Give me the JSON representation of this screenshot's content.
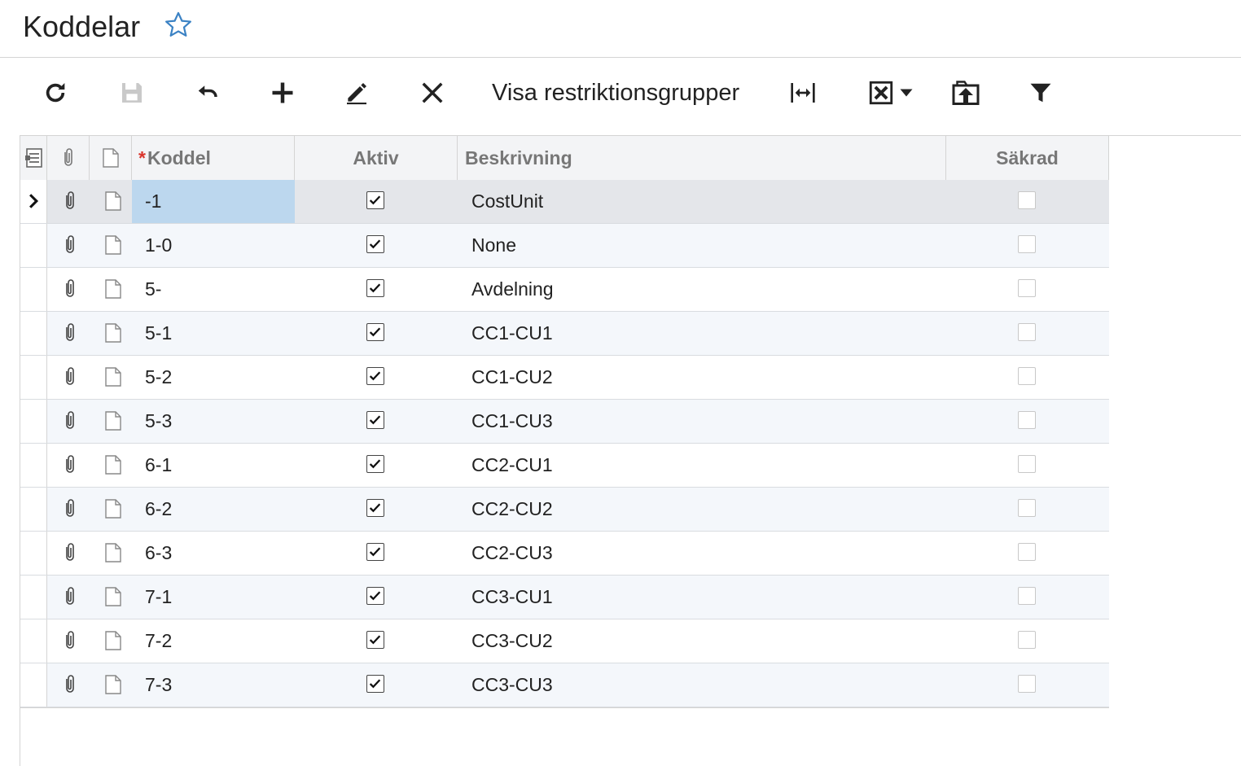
{
  "page": {
    "title": "Koddelar"
  },
  "toolbar": {
    "restriction_groups_label": "Visa restriktionsgrupper"
  },
  "grid": {
    "columns": {
      "koddel": "Koddel",
      "koddel_required_marker": "*",
      "aktiv": "Aktiv",
      "beskrivning": "Beskrivning",
      "sakrad": "Säkrad"
    },
    "rows": [
      {
        "koddel": "-1",
        "aktiv": true,
        "beskrivning": "CostUnit",
        "sakrad": false,
        "selected": true
      },
      {
        "koddel": "1-0",
        "aktiv": true,
        "beskrivning": "None",
        "sakrad": false
      },
      {
        "koddel": "5-",
        "aktiv": true,
        "beskrivning": "Avdelning",
        "sakrad": false
      },
      {
        "koddel": "5-1",
        "aktiv": true,
        "beskrivning": "CC1-CU1",
        "sakrad": false
      },
      {
        "koddel": "5-2",
        "aktiv": true,
        "beskrivning": "CC1-CU2",
        "sakrad": false
      },
      {
        "koddel": "5-3",
        "aktiv": true,
        "beskrivning": "CC1-CU3",
        "sakrad": false
      },
      {
        "koddel": "6-1",
        "aktiv": true,
        "beskrivning": "CC2-CU1",
        "sakrad": false
      },
      {
        "koddel": "6-2",
        "aktiv": true,
        "beskrivning": "CC2-CU2",
        "sakrad": false
      },
      {
        "koddel": "6-3",
        "aktiv": true,
        "beskrivning": "CC2-CU3",
        "sakrad": false
      },
      {
        "koddel": "7-1",
        "aktiv": true,
        "beskrivning": "CC3-CU1",
        "sakrad": false
      },
      {
        "koddel": "7-2",
        "aktiv": true,
        "beskrivning": "CC3-CU2",
        "sakrad": false
      },
      {
        "koddel": "7-3",
        "aktiv": true,
        "beskrivning": "CC3-CU3",
        "sakrad": false
      }
    ]
  },
  "colors": {
    "selected_cell": "#bcd7ee",
    "selected_row": "#e4e6ea",
    "alt_row": "#f4f7fb",
    "header_bg": "#f3f4f6",
    "required_star": "#d9342b",
    "star_icon": "#3b82c4"
  }
}
